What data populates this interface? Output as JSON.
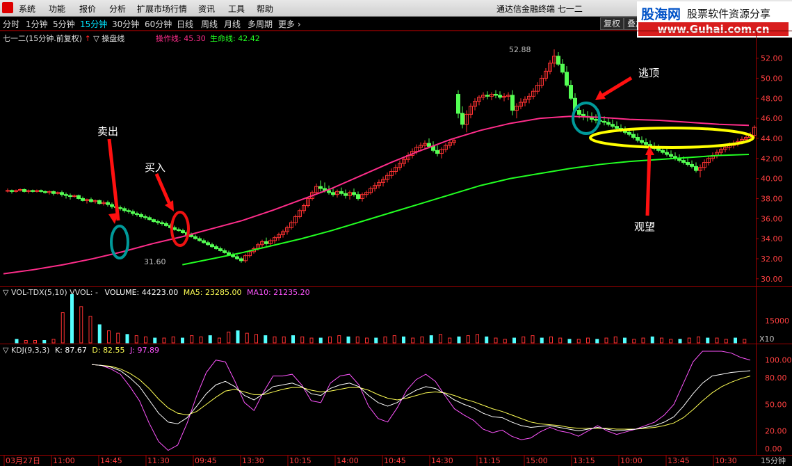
{
  "menu": [
    "系统",
    "功能",
    "报价",
    "分析",
    "扩展市场行情",
    "资讯",
    "工具",
    "帮助"
  ],
  "window_title": "通达信金融终端  七一二",
  "brand": {
    "cn": "股海网",
    "slogan": "股票软件资源分享",
    "url": "www.Guhai.com.cn"
  },
  "tabs": [
    "分时",
    "1分钟",
    "5分钟",
    "15分钟",
    "30分钟",
    "60分钟",
    "日线",
    "周线",
    "月线",
    "多周期",
    "更多"
  ],
  "active_tab": "15分钟",
  "right_buttons": [
    "复权",
    "叠加"
  ],
  "main_panel": {
    "stock": "七一二(15分钟.前复权)",
    "indicator": "操盘线",
    "op_line_label": "操作线: 45.30",
    "life_line_label": "生命线: 42.42",
    "high_label": "52.88",
    "low_label": "31.60"
  },
  "vol_panel": {
    "name": "VOL-TDX(5,10)",
    "vvol": "VVOL: -",
    "volume": "VOLUME: 44223.00",
    "ma5": "MA5: 23285.00",
    "ma10": "MA10: 21235.20",
    "axis_label": "15000",
    "unit": "X10"
  },
  "kdj_panel": {
    "name": "KDJ(9,3,3)",
    "k": "K: 87.67",
    "d": "D: 82.55",
    "j": "J: 97.89",
    "axis_labels": [
      "100.00",
      "80.00",
      "50.00",
      "20.00",
      "0.00"
    ],
    "period": "15分钟"
  },
  "annotations": {
    "sell": "卖出",
    "buy": "买入",
    "escape": "逃顶",
    "watch": "观望"
  },
  "price_axis": [
    "52.00",
    "50.00",
    "48.00",
    "46.00",
    "44.00",
    "42.00",
    "40.00",
    "38.00",
    "36.00",
    "34.00",
    "32.00",
    "30.00"
  ],
  "time_axis": [
    "03月27日",
    "11:00",
    "14:45",
    "11:30",
    "09:45",
    "13:30",
    "10:15",
    "14:00",
    "10:45",
    "14:30",
    "11:15",
    "15:00",
    "13:15",
    "10:00",
    "13:45",
    "10:30"
  ],
  "colors": {
    "up": "#ff3232",
    "down": "#54ff54",
    "op_line": "#ff2d8a",
    "life_line": "#22ff22",
    "axis_text": "#ff4040",
    "vol_down": "#54ffff",
    "k": "#ffffff",
    "d": "#ffff55",
    "j": "#ff55ff",
    "circle_cyan": "#009999",
    "circle_red": "#ee1111",
    "ellipse": "#ffff00"
  },
  "chart_data": {
    "type": "candlestick",
    "ylim": [
      29.5,
      53.5
    ],
    "candles": [
      [
        38.8,
        39.0,
        38.6,
        38.8
      ],
      [
        38.8,
        38.9,
        38.5,
        38.7
      ],
      [
        38.7,
        38.9,
        38.6,
        38.8
      ],
      [
        38.8,
        39.0,
        38.7,
        38.9
      ],
      [
        38.9,
        39.0,
        38.6,
        38.7
      ],
      [
        38.7,
        38.9,
        38.5,
        38.8
      ],
      [
        38.8,
        38.9,
        38.6,
        38.7
      ],
      [
        38.7,
        38.9,
        38.6,
        38.8
      ],
      [
        38.8,
        38.9,
        38.6,
        38.7
      ],
      [
        38.7,
        38.8,
        38.5,
        38.6
      ],
      [
        38.6,
        38.8,
        38.4,
        38.7
      ],
      [
        38.7,
        38.8,
        38.3,
        38.5
      ],
      [
        38.5,
        38.7,
        38.4,
        38.6
      ],
      [
        38.6,
        38.8,
        38.2,
        38.4
      ],
      [
        38.4,
        38.6,
        38.0,
        38.3
      ],
      [
        38.3,
        38.5,
        37.9,
        38.2
      ],
      [
        38.2,
        38.4,
        38.1,
        38.3
      ],
      [
        38.3,
        38.4,
        37.9,
        38.0
      ],
      [
        38.0,
        38.2,
        37.7,
        37.8
      ],
      [
        37.8,
        38.0,
        37.5,
        37.9
      ],
      [
        37.9,
        38.1,
        37.6,
        37.7
      ],
      [
        37.7,
        37.9,
        37.5,
        37.8
      ],
      [
        37.8,
        37.9,
        37.4,
        37.5
      ],
      [
        37.5,
        37.8,
        37.3,
        37.6
      ],
      [
        37.6,
        37.8,
        37.2,
        37.4
      ],
      [
        37.4,
        37.6,
        37.0,
        37.2
      ],
      [
        37.2,
        37.4,
        36.9,
        37.1
      ],
      [
        37.1,
        37.3,
        36.8,
        37.0
      ],
      [
        37.0,
        37.2,
        36.6,
        36.8
      ],
      [
        36.8,
        37.0,
        36.5,
        36.7
      ],
      [
        36.7,
        36.9,
        36.3,
        36.5
      ],
      [
        36.5,
        36.7,
        36.2,
        36.4
      ],
      [
        36.4,
        36.6,
        36.0,
        36.2
      ],
      [
        36.2,
        36.4,
        35.9,
        36.1
      ],
      [
        36.1,
        36.3,
        35.8,
        35.9
      ],
      [
        35.9,
        36.0,
        35.6,
        35.7
      ],
      [
        35.7,
        35.9,
        35.4,
        35.6
      ],
      [
        35.6,
        35.8,
        35.3,
        35.5
      ],
      [
        35.5,
        35.7,
        35.2,
        35.3
      ],
      [
        35.3,
        35.5,
        35.0,
        35.1
      ],
      [
        35.1,
        35.3,
        34.8,
        34.9
      ],
      [
        34.9,
        35.1,
        34.7,
        34.8
      ],
      [
        34.8,
        35.0,
        34.5,
        34.6
      ],
      [
        34.6,
        34.8,
        34.3,
        34.4
      ],
      [
        34.4,
        34.6,
        34.1,
        34.2
      ],
      [
        34.2,
        34.4,
        33.9,
        34.0
      ],
      [
        34.0,
        34.2,
        33.7,
        33.8
      ],
      [
        33.8,
        34.0,
        33.5,
        33.6
      ],
      [
        33.6,
        33.8,
        33.3,
        33.4
      ],
      [
        33.4,
        33.6,
        33.1,
        33.2
      ],
      [
        33.2,
        33.4,
        32.9,
        33.0
      ],
      [
        33.0,
        33.2,
        32.7,
        32.8
      ],
      [
        32.8,
        33.0,
        32.5,
        32.6
      ],
      [
        32.6,
        32.8,
        32.3,
        32.4
      ],
      [
        32.4,
        32.6,
        32.1,
        32.2
      ],
      [
        32.2,
        32.4,
        31.9,
        32.0
      ],
      [
        32.0,
        32.2,
        31.6,
        31.8
      ],
      [
        31.8,
        32.5,
        31.6,
        32.3
      ],
      [
        32.3,
        32.9,
        32.1,
        32.7
      ],
      [
        32.7,
        33.2,
        32.5,
        33.0
      ],
      [
        33.0,
        33.6,
        32.8,
        33.4
      ],
      [
        33.4,
        33.9,
        33.1,
        33.7
      ],
      [
        33.7,
        34.1,
        33.3,
        33.5
      ],
      [
        33.5,
        34.0,
        33.2,
        33.8
      ],
      [
        33.8,
        34.3,
        33.5,
        34.1
      ],
      [
        34.1,
        34.6,
        33.8,
        34.4
      ],
      [
        34.4,
        34.9,
        34.1,
        34.7
      ],
      [
        34.7,
        35.3,
        34.4,
        35.1
      ],
      [
        35.1,
        35.8,
        34.9,
        35.6
      ],
      [
        35.6,
        36.4,
        35.3,
        36.2
      ],
      [
        36.2,
        37.0,
        36.0,
        36.8
      ],
      [
        36.8,
        37.5,
        36.5,
        37.3
      ],
      [
        37.3,
        38.2,
        37.1,
        38.0
      ],
      [
        38.0,
        38.8,
        37.8,
        38.6
      ],
      [
        38.6,
        39.5,
        38.4,
        39.2
      ],
      [
        39.2,
        39.8,
        38.7,
        39.0
      ],
      [
        39.0,
        39.6,
        38.6,
        38.8
      ],
      [
        38.8,
        39.3,
        38.4,
        38.6
      ],
      [
        38.6,
        39.0,
        38.2,
        38.4
      ],
      [
        38.4,
        38.9,
        38.1,
        38.7
      ],
      [
        38.7,
        39.1,
        38.3,
        38.5
      ],
      [
        38.5,
        38.9,
        38.0,
        38.3
      ],
      [
        38.3,
        38.8,
        37.9,
        38.6
      ],
      [
        38.6,
        39.0,
        38.2,
        38.4
      ],
      [
        38.4,
        38.7,
        37.8,
        38.0
      ],
      [
        38.0,
        38.6,
        37.7,
        38.4
      ],
      [
        38.4,
        38.8,
        38.1,
        38.6
      ],
      [
        38.6,
        39.2,
        38.4,
        39.0
      ],
      [
        39.0,
        39.6,
        38.7,
        39.3
      ],
      [
        39.3,
        39.9,
        39.0,
        39.6
      ],
      [
        39.6,
        40.2,
        39.2,
        39.9
      ],
      [
        39.9,
        40.6,
        39.6,
        40.3
      ],
      [
        40.3,
        41.0,
        40.0,
        40.7
      ],
      [
        40.7,
        41.4,
        40.4,
        41.1
      ],
      [
        41.1,
        41.8,
        40.8,
        41.5
      ],
      [
        41.5,
        42.2,
        41.2,
        41.9
      ],
      [
        41.9,
        42.6,
        41.6,
        42.3
      ],
      [
        42.3,
        43.0,
        42.0,
        42.7
      ],
      [
        42.7,
        43.4,
        42.4,
        43.1
      ],
      [
        43.1,
        43.6,
        42.7,
        43.3
      ],
      [
        43.3,
        43.8,
        42.9,
        43.5
      ],
      [
        43.5,
        44.0,
        43.0,
        43.2
      ],
      [
        43.2,
        43.7,
        42.6,
        42.8
      ],
      [
        42.8,
        43.3,
        42.2,
        42.5
      ],
      [
        42.5,
        43.1,
        42.0,
        42.9
      ],
      [
        42.9,
        43.5,
        42.6,
        43.3
      ],
      [
        43.3,
        43.8,
        43.0,
        43.6
      ],
      [
        43.6,
        44.0,
        43.3,
        43.8
      ],
      [
        48.4,
        48.8,
        46.0,
        46.5
      ],
      [
        46.5,
        47.2,
        45.0,
        45.4
      ],
      [
        45.4,
        46.8,
        44.6,
        46.4
      ],
      [
        46.4,
        47.5,
        46.0,
        47.2
      ],
      [
        47.2,
        48.0,
        46.8,
        47.7
      ],
      [
        47.7,
        48.3,
        47.3,
        48.1
      ],
      [
        48.1,
        48.6,
        47.8,
        48.3
      ],
      [
        48.3,
        48.7,
        47.9,
        48.2
      ],
      [
        48.2,
        48.6,
        47.8,
        48.4
      ],
      [
        48.4,
        48.8,
        48.0,
        48.3
      ],
      [
        48.3,
        48.7,
        47.9,
        48.1
      ],
      [
        48.1,
        48.5,
        47.7,
        48.2
      ],
      [
        48.2,
        48.6,
        47.8,
        48.3
      ],
      [
        48.3,
        48.8,
        46.3,
        46.8
      ],
      [
        46.8,
        47.5,
        46.0,
        47.2
      ],
      [
        47.2,
        48.0,
        46.9,
        47.6
      ],
      [
        47.6,
        48.2,
        47.2,
        47.9
      ],
      [
        47.9,
        48.5,
        47.5,
        48.2
      ],
      [
        48.2,
        49.0,
        47.9,
        48.7
      ],
      [
        48.7,
        49.6,
        48.4,
        49.3
      ],
      [
        49.3,
        50.3,
        49.0,
        50.0
      ],
      [
        50.0,
        51.0,
        49.7,
        50.7
      ],
      [
        50.7,
        51.8,
        50.4,
        51.5
      ],
      [
        51.5,
        52.88,
        51.1,
        52.2
      ],
      [
        52.2,
        52.6,
        51.2,
        51.4
      ],
      [
        51.4,
        51.9,
        50.4,
        50.6
      ],
      [
        50.6,
        51.2,
        49.1,
        49.3
      ],
      [
        49.3,
        49.8,
        47.8,
        48.0
      ],
      [
        48.0,
        48.5,
        46.6,
        46.8
      ],
      [
        46.8,
        47.3,
        46.0,
        46.4
      ],
      [
        46.4,
        46.9,
        45.8,
        46.2
      ],
      [
        46.2,
        46.7,
        45.7,
        46.1
      ],
      [
        46.1,
        46.6,
        45.6,
        45.9
      ],
      [
        45.9,
        46.4,
        45.5,
        45.8
      ],
      [
        45.8,
        46.3,
        45.4,
        45.7
      ],
      [
        45.7,
        46.2,
        45.3,
        45.6
      ],
      [
        45.6,
        46.0,
        45.2,
        45.4
      ],
      [
        45.4,
        45.9,
        45.0,
        45.2
      ],
      [
        45.2,
        45.7,
        44.8,
        45.0
      ],
      [
        45.0,
        45.4,
        44.6,
        44.8
      ],
      [
        44.8,
        45.2,
        44.4,
        44.6
      ],
      [
        44.6,
        45.0,
        44.2,
        44.4
      ],
      [
        44.4,
        44.8,
        43.9,
        44.1
      ],
      [
        44.1,
        44.5,
        43.6,
        43.8
      ],
      [
        43.8,
        44.2,
        43.4,
        43.6
      ],
      [
        43.6,
        44.0,
        43.2,
        43.4
      ],
      [
        43.4,
        43.8,
        43.0,
        43.2
      ],
      [
        43.2,
        43.6,
        42.8,
        43.0
      ],
      [
        43.0,
        43.4,
        42.6,
        42.8
      ],
      [
        42.8,
        43.2,
        42.4,
        42.6
      ],
      [
        42.6,
        43.0,
        42.2,
        42.4
      ],
      [
        42.4,
        42.8,
        42.0,
        42.2
      ],
      [
        42.2,
        42.6,
        41.8,
        42.0
      ],
      [
        42.0,
        42.4,
        41.6,
        41.8
      ],
      [
        41.8,
        42.2,
        41.4,
        41.6
      ],
      [
        41.6,
        42.0,
        41.2,
        41.4
      ],
      [
        41.4,
        41.8,
        41.0,
        41.2
      ],
      [
        41.2,
        41.6,
        40.6,
        40.8
      ],
      [
        40.8,
        41.4,
        40.1,
        41.1
      ],
      [
        41.1,
        41.9,
        40.8,
        41.6
      ],
      [
        41.6,
        42.3,
        41.3,
        42.0
      ],
      [
        42.0,
        42.6,
        41.7,
        42.3
      ],
      [
        42.3,
        42.9,
        42.0,
        42.6
      ],
      [
        42.6,
        43.1,
        42.3,
        42.9
      ],
      [
        42.9,
        43.4,
        42.6,
        43.1
      ],
      [
        43.1,
        43.6,
        42.8,
        43.3
      ],
      [
        43.3,
        43.8,
        43.0,
        43.5
      ],
      [
        43.5,
        44.0,
        43.2,
        43.7
      ],
      [
        43.7,
        44.2,
        43.4,
        43.9
      ],
      [
        43.9,
        44.4,
        43.6,
        44.1
      ],
      [
        44.1,
        44.6,
        43.8,
        44.3
      ],
      [
        44.3,
        45.3,
        44.0,
        45.1
      ]
    ],
    "op_line": [
      30.5,
      30.9,
      31.4,
      32.0,
      32.7,
      33.5,
      34.2,
      35.0,
      35.8,
      36.8,
      37.9,
      39.0,
      40.3,
      41.6,
      42.8,
      43.9,
      44.8,
      45.5,
      46.0,
      46.2,
      46.1,
      45.9,
      45.8,
      45.6,
      45.4,
      45.3
    ],
    "life_line": [
      null,
      null,
      null,
      null,
      null,
      null,
      31.4,
      32.0,
      32.6,
      33.3,
      34.0,
      34.8,
      35.7,
      36.6,
      37.5,
      38.4,
      39.3,
      40.0,
      40.5,
      41.0,
      41.4,
      41.7,
      41.9,
      42.1,
      42.3,
      42.4
    ],
    "volume": [
      3,
      2,
      2,
      2,
      3,
      25,
      40,
      30,
      22,
      15,
      10,
      8,
      7,
      6,
      5,
      4,
      4,
      5,
      4,
      6,
      5,
      6,
      4,
      9,
      10,
      8,
      7,
      6,
      5,
      5,
      6,
      5,
      4,
      4,
      5,
      6,
      5,
      5,
      4,
      4,
      5,
      6,
      5,
      4,
      5,
      6,
      7,
      4,
      5,
      6,
      7,
      5,
      4,
      3,
      4,
      5,
      6,
      4,
      5,
      4,
      3,
      3,
      4,
      3,
      4,
      5,
      4,
      3,
      4,
      5,
      4,
      3,
      3,
      4,
      5,
      4,
      4,
      3,
      4,
      3
    ],
    "kdj_k": [
      95,
      94,
      92,
      88,
      80,
      70,
      55,
      40,
      30,
      28,
      35,
      48,
      62,
      72,
      76,
      70,
      60,
      55,
      62,
      70,
      72,
      74,
      70,
      62,
      60,
      68,
      72,
      74,
      70,
      60,
      52,
      48,
      52,
      60,
      66,
      70,
      68,
      62,
      55,
      50,
      46,
      40,
      36,
      35,
      30,
      26,
      24,
      25,
      26,
      24,
      22,
      20,
      22,
      24,
      22,
      20,
      21,
      22,
      24,
      26,
      30,
      36,
      48,
      62,
      74,
      82,
      84,
      86,
      87,
      88
    ],
    "kdj_d": [
      95,
      94,
      93,
      90,
      85,
      78,
      68,
      56,
      46,
      40,
      38,
      42,
      50,
      58,
      65,
      67,
      64,
      61,
      61,
      64,
      67,
      69,
      69,
      66,
      64,
      65,
      67,
      69,
      69,
      66,
      61,
      57,
      55,
      57,
      60,
      63,
      64,
      63,
      60,
      56,
      53,
      49,
      45,
      42,
      38,
      34,
      30,
      28,
      27,
      26,
      24,
      23,
      23,
      23,
      23,
      22,
      22,
      22,
      23,
      24,
      26,
      29,
      35,
      44,
      54,
      63,
      70,
      75,
      79,
      82
    ]
  }
}
